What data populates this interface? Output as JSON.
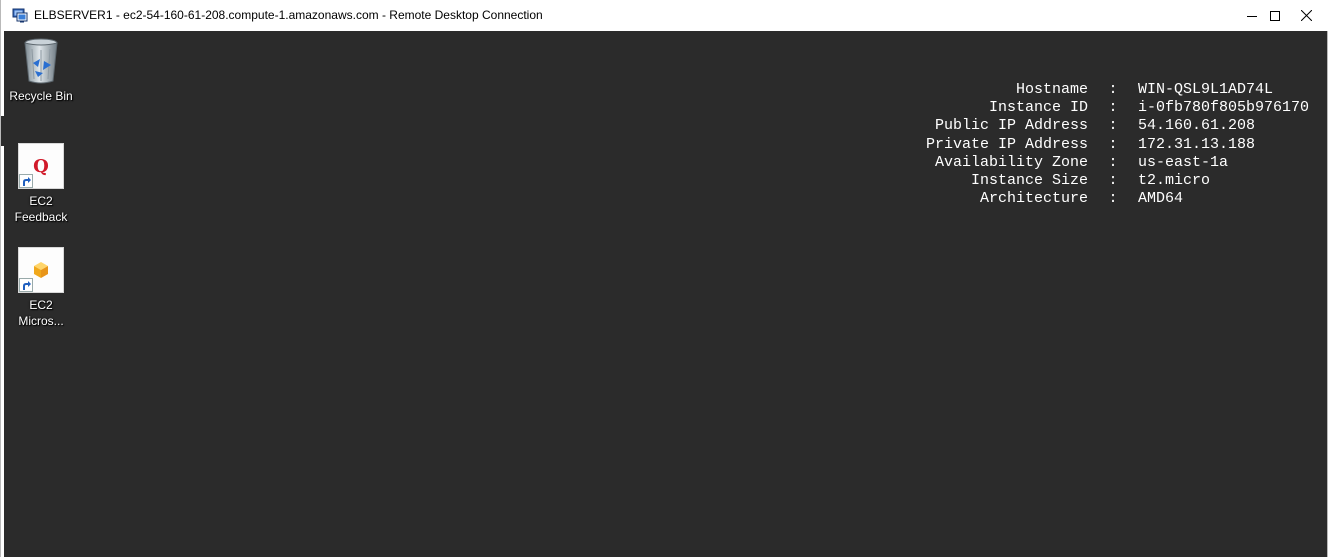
{
  "window": {
    "title": "ELBSERVER1 - ec2-54-160-61-208.compute-1.amazonaws.com - Remote Desktop Connection",
    "controls": [
      "minimize",
      "maximize",
      "close"
    ]
  },
  "desktop": {
    "icons": [
      {
        "name": "recycle-bin",
        "label": "Recycle Bin",
        "icon": "recycle-bin-icon"
      },
      {
        "name": "ec2-feedback",
        "label_line1": "EC2",
        "label_line2": "Feedback",
        "icon": "feedback-q-icon"
      },
      {
        "name": "ec2-microsoft",
        "label_line1": "EC2",
        "label_line2": "Micros...",
        "icon": "aws-box-icon"
      }
    ]
  },
  "bginfo": {
    "separator": ":",
    "rows": [
      {
        "key": "Hostname",
        "value": "WIN-QSL9L1AD74L"
      },
      {
        "key": "Instance ID",
        "value": "i-0fb780f805b976170"
      },
      {
        "key": "Public IP Address",
        "value": "54.160.61.208"
      },
      {
        "key": "Private IP Address",
        "value": "172.31.13.188"
      },
      {
        "key": "Availability Zone",
        "value": "us-east-1a"
      },
      {
        "key": "Instance Size",
        "value": "t2.micro"
      },
      {
        "key": "Architecture",
        "value": "AMD64"
      }
    ]
  },
  "colors": {
    "desktop_background": "#2b2b2b",
    "titlebar": "#ffffff",
    "text_on_desktop": "#ffffff"
  }
}
